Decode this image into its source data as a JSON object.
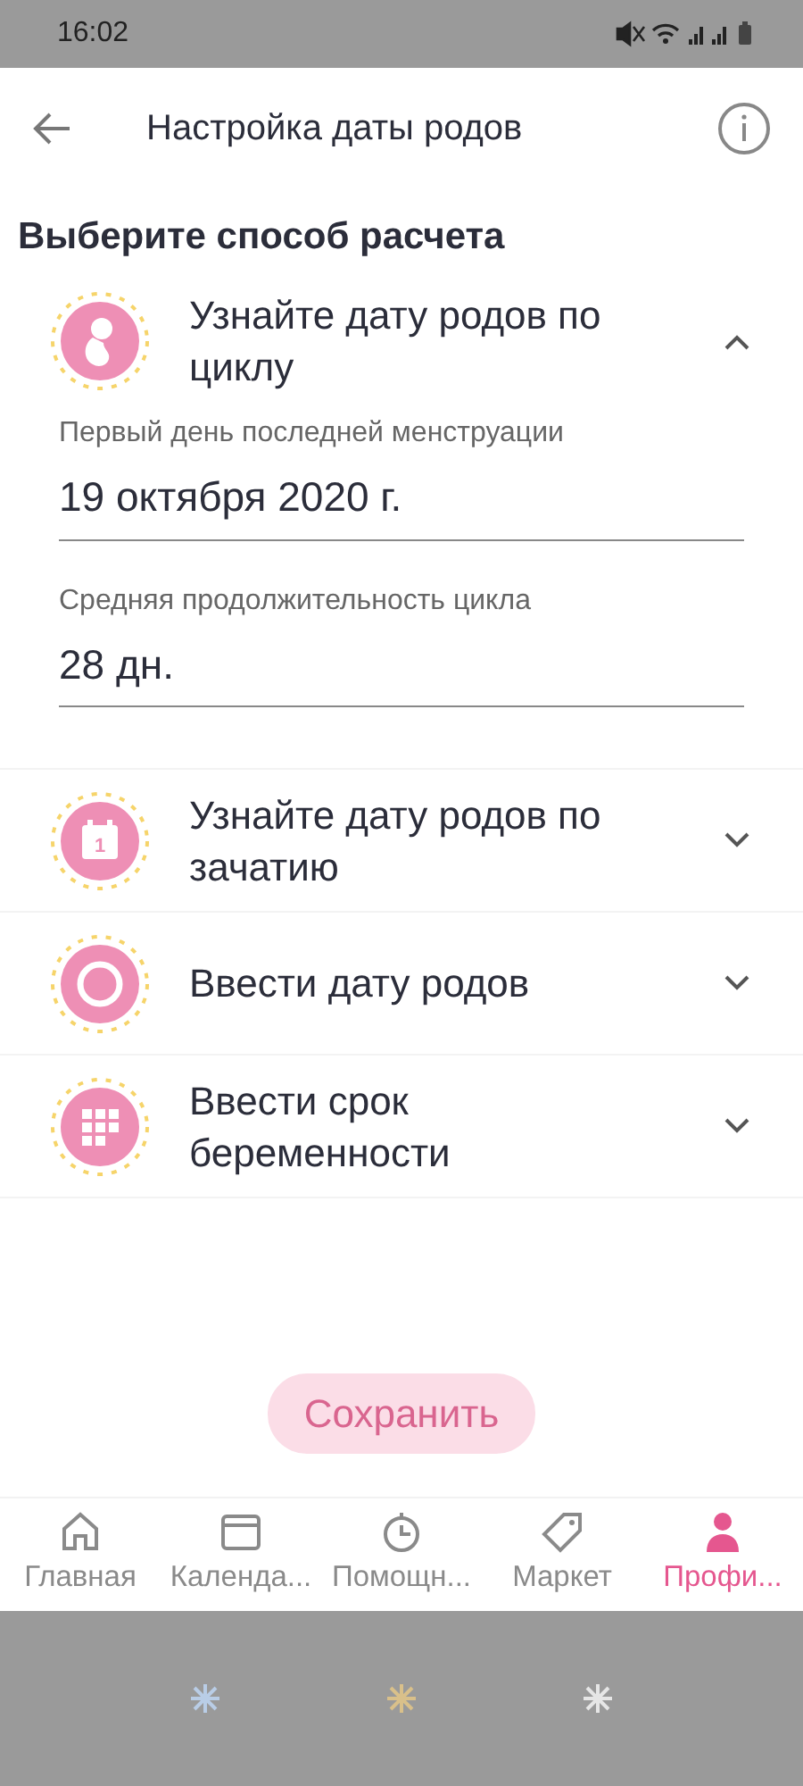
{
  "status_bar": {
    "time": "16:02"
  },
  "header": {
    "title": "Настройка даты родов"
  },
  "heading": "Выберите способ расчета",
  "methods": [
    {
      "kind": "fetus",
      "title": "Узнайте дату родов по циклу",
      "expanded": true,
      "fields": [
        {
          "label": "Первый день последней менструации",
          "value": "19 октября 2020 г."
        },
        {
          "label": "Средняя продолжительность цикла",
          "value": "28 дн."
        }
      ]
    },
    {
      "kind": "calendar",
      "icon_text": "1",
      "title": "Узнайте дату родов по зачатию",
      "expanded": false
    },
    {
      "kind": "ring",
      "title": "Ввести дату родов",
      "expanded": false
    },
    {
      "kind": "grid",
      "title": "Ввести срок беременности",
      "expanded": false
    }
  ],
  "save_button": {
    "label": "Сохранить",
    "disabled": true
  },
  "tabs": [
    {
      "kind": "home",
      "label": "Главная",
      "selected": false
    },
    {
      "kind": "calendar",
      "label": "Календа...",
      "selected": false
    },
    {
      "kind": "timer",
      "label": "Помощн...",
      "selected": false
    },
    {
      "kind": "tag",
      "label": "Маркет",
      "selected": false
    },
    {
      "kind": "person",
      "label": "Профи...",
      "selected": true
    }
  ]
}
